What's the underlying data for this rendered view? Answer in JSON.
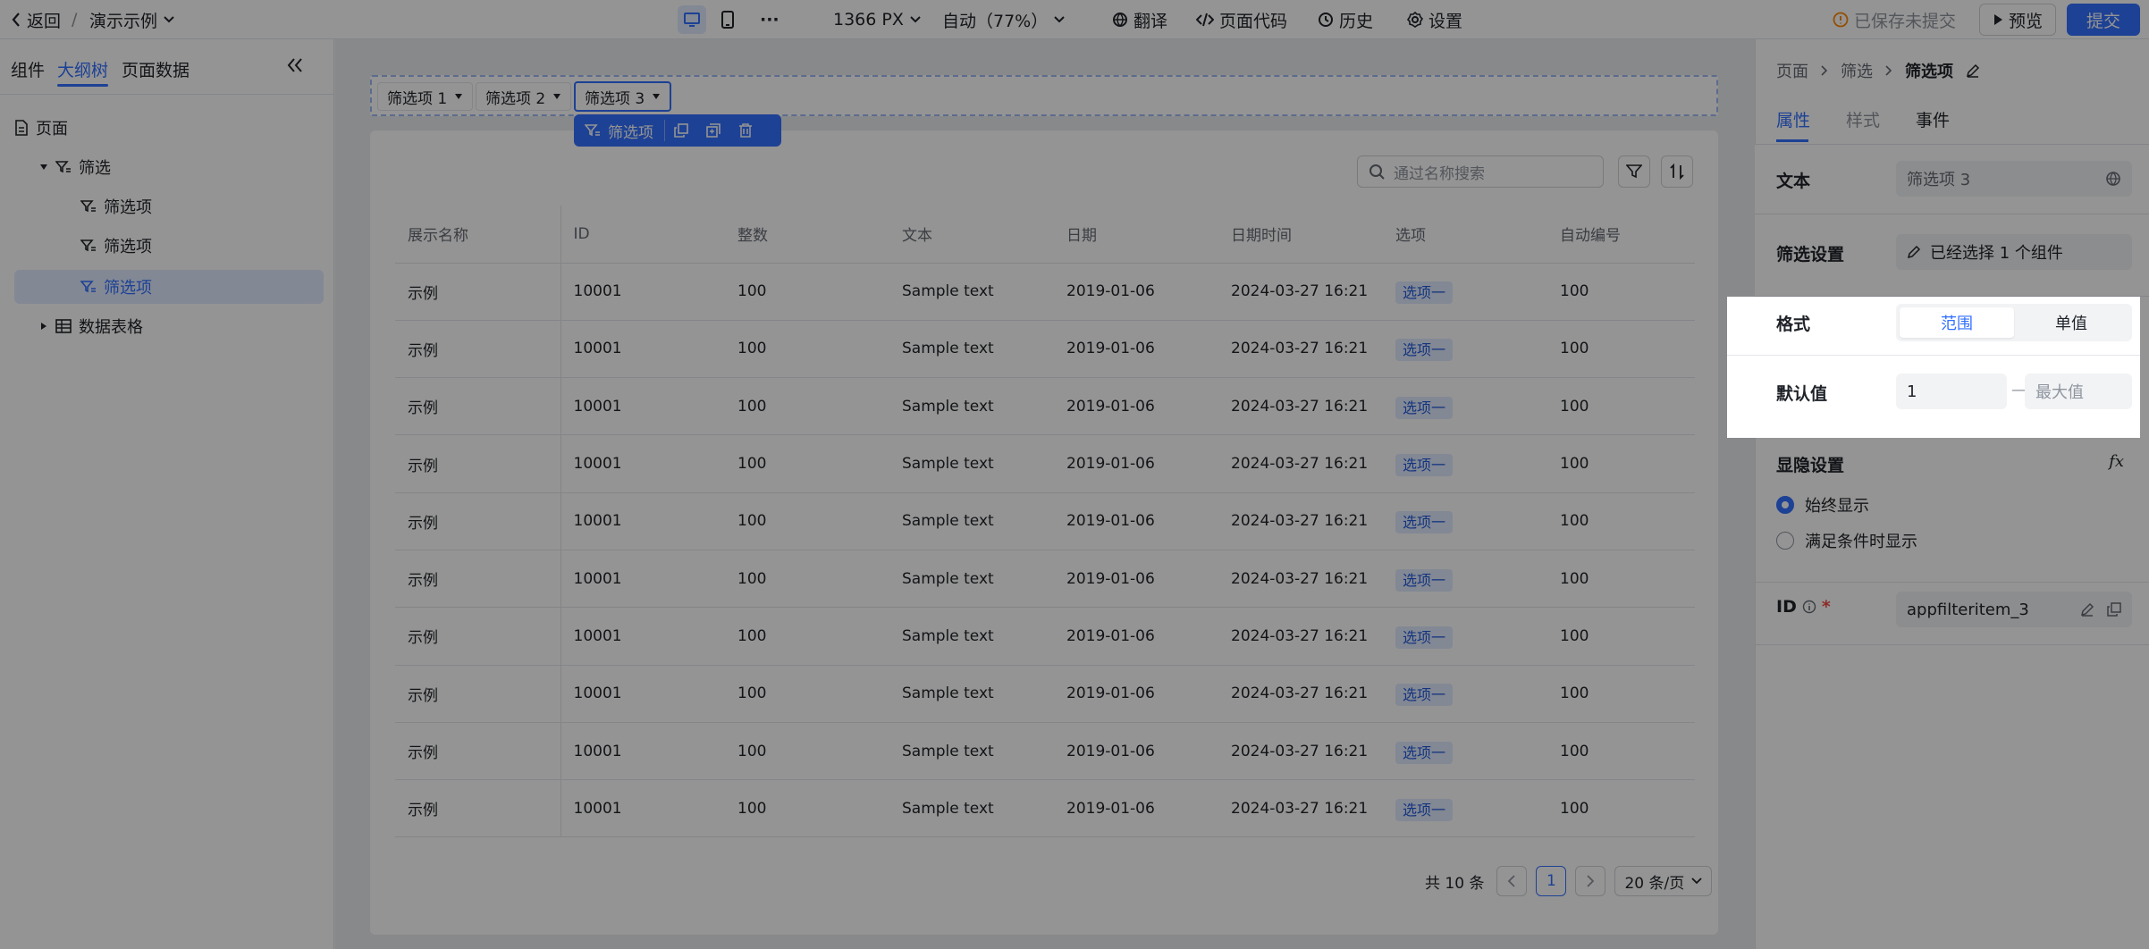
{
  "topbar": {
    "back": "返回",
    "separator": "/",
    "app_name": "演示示例",
    "resolution": "1366 PX",
    "zoom": "自动（77%）",
    "translate": "翻译",
    "page_code": "页面代码",
    "history": "历史",
    "settings": "设置",
    "save_status": "已保存未提交",
    "preview": "预览",
    "submit": "提交",
    "more": "···"
  },
  "left_panel": {
    "tabs": [
      "组件",
      "大纲树",
      "页面数据"
    ],
    "tree": [
      {
        "label": "页面"
      },
      {
        "label": "筛选"
      },
      {
        "label": "筛选项"
      },
      {
        "label": "筛选项"
      },
      {
        "label": "筛选项"
      },
      {
        "label": "数据表格"
      }
    ]
  },
  "canvas": {
    "filter_chips": [
      "筛选项 1",
      "筛选项 2",
      "筛选项 3"
    ],
    "floating_toolbar_label": "筛选项",
    "search_placeholder": "通过名称搜索",
    "table": {
      "headers": [
        "展示名称",
        "ID",
        "整数",
        "文本",
        "日期",
        "日期时间",
        "选项",
        "自动编号"
      ],
      "rows": [
        [
          "示例",
          "10001",
          "100",
          "Sample text",
          "2019-01-06",
          "2024-03-27 16:21",
          "选项一",
          "100"
        ],
        [
          "示例",
          "10001",
          "100",
          "Sample text",
          "2019-01-06",
          "2024-03-27 16:21",
          "选项一",
          "100"
        ],
        [
          "示例",
          "10001",
          "100",
          "Sample text",
          "2019-01-06",
          "2024-03-27 16:21",
          "选项一",
          "100"
        ],
        [
          "示例",
          "10001",
          "100",
          "Sample text",
          "2019-01-06",
          "2024-03-27 16:21",
          "选项一",
          "100"
        ],
        [
          "示例",
          "10001",
          "100",
          "Sample text",
          "2019-01-06",
          "2024-03-27 16:21",
          "选项一",
          "100"
        ],
        [
          "示例",
          "10001",
          "100",
          "Sample text",
          "2019-01-06",
          "2024-03-27 16:21",
          "选项一",
          "100"
        ],
        [
          "示例",
          "10001",
          "100",
          "Sample text",
          "2019-01-06",
          "2024-03-27 16:21",
          "选项一",
          "100"
        ],
        [
          "示例",
          "10001",
          "100",
          "Sample text",
          "2019-01-06",
          "2024-03-27 16:21",
          "选项一",
          "100"
        ],
        [
          "示例",
          "10001",
          "100",
          "Sample text",
          "2019-01-06",
          "2024-03-27 16:21",
          "选项一",
          "100"
        ],
        [
          "示例",
          "10001",
          "100",
          "Sample text",
          "2019-01-06",
          "2024-03-27 16:21",
          "选项一",
          "100"
        ]
      ]
    },
    "pagination": {
      "total": "共 10 条",
      "current_page": "1",
      "page_size": "20 条/页"
    }
  },
  "right_panel": {
    "breadcrumb": [
      "页面",
      "筛选",
      "筛选项"
    ],
    "tabs": [
      "属性",
      "样式",
      "事件"
    ],
    "text_label": "文本",
    "text_value": "筛选项 3",
    "filter_setting_label": "筛选设置",
    "filter_setting_value": "已经选择 1 个组件",
    "format_label": "格式",
    "format_options": [
      "范围",
      "单值"
    ],
    "default_label": "默认值",
    "default_min": "1",
    "default_dash": "—",
    "default_max_placeholder": "最大值",
    "visibility_label": "显隐设置",
    "fx": "fx",
    "visibility_options": [
      "始终显示",
      "满足条件时显示"
    ],
    "id_label": "ID",
    "id_required": "*",
    "id_value": "appfilteritem_3"
  },
  "colors": {
    "accent": "#3370ff",
    "tag_bg": "#e1eaff",
    "overlay": "rgba(0,0,0,0.42)"
  }
}
